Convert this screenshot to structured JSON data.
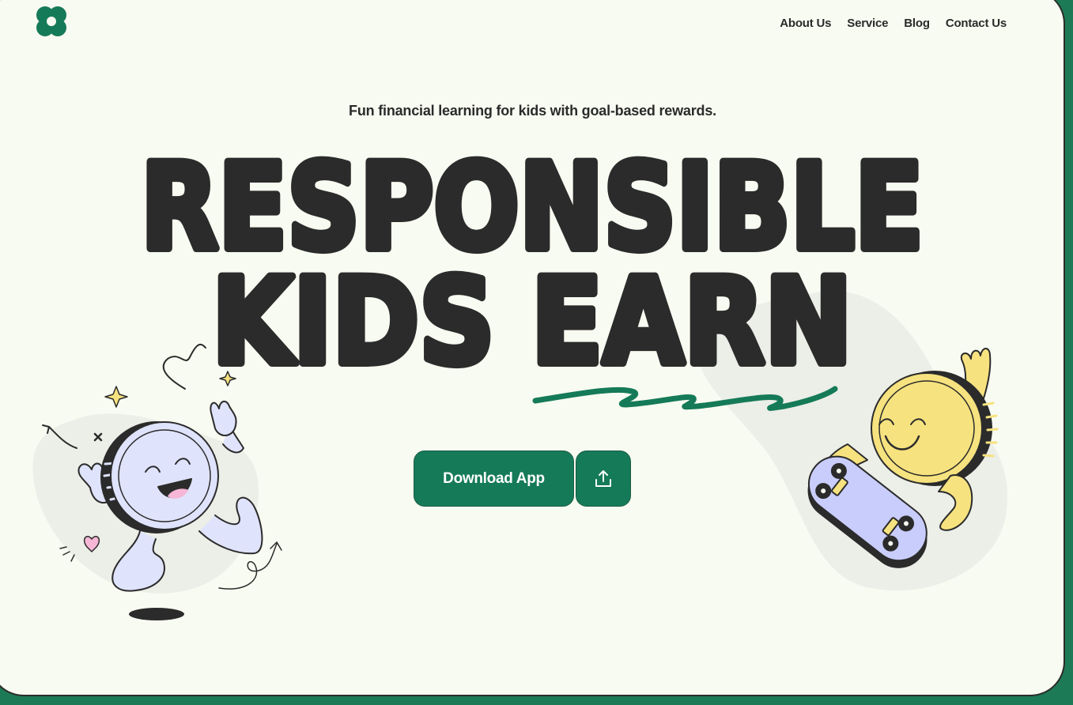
{
  "nav": {
    "items": [
      "About Us",
      "Service",
      "Blog",
      "Contact Us"
    ]
  },
  "hero": {
    "tagline": "Fun financial learning for kids with goal-based rewards.",
    "headline_line1": "RESPONSIBLE",
    "headline_line2": "KIDS EARN"
  },
  "cta": {
    "download_label": "Download App",
    "share_icon": "upload-icon"
  },
  "colors": {
    "background": "#f8fbf1",
    "brand_green": "#157a58",
    "text_dark": "#2b2b2b",
    "coin_purple": "#dfe3fb",
    "coin_yellow": "#f6e27f"
  }
}
